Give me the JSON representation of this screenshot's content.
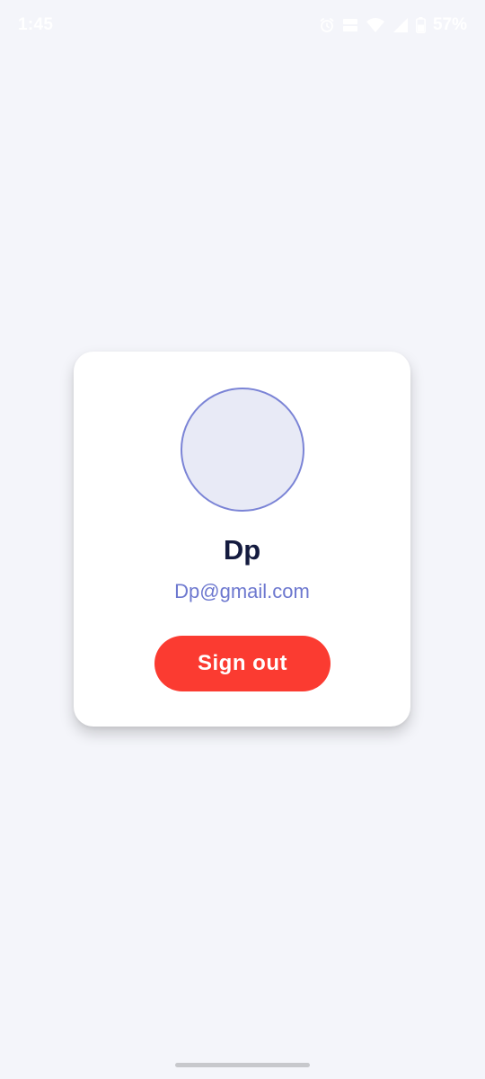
{
  "status_bar": {
    "time": "1:45",
    "battery": "57%",
    "icons": [
      "alarm-icon",
      "volte-icon",
      "wifi-icon",
      "signal-icon",
      "battery-icon"
    ]
  },
  "profile": {
    "name": "Dp",
    "email": "Dp@gmail.com",
    "sign_out_label": "Sign out"
  },
  "colors": {
    "background": "#f4f5fa",
    "card": "#ffffff",
    "avatar_fill": "#e8eaf6",
    "avatar_border": "#7b84d6",
    "name_text": "#141b3f",
    "email_text": "#6d78cf",
    "sign_out_button": "#fb3b31"
  }
}
